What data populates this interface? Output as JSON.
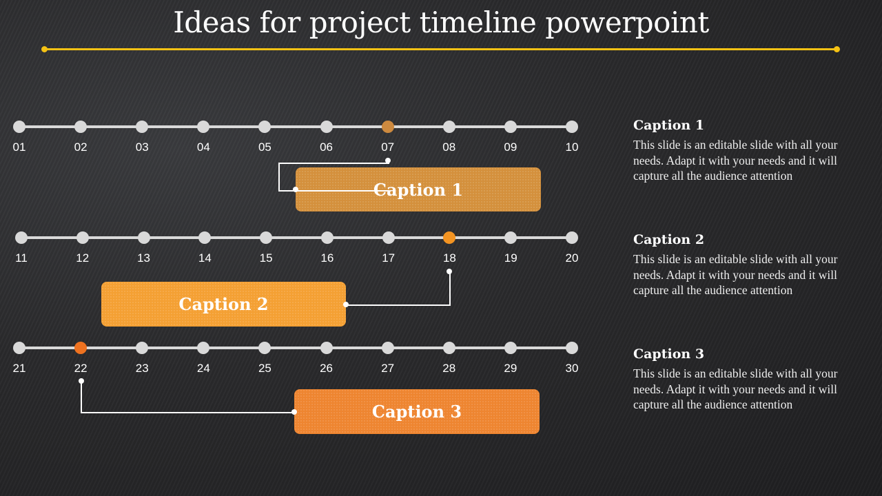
{
  "title": "Ideas for project timeline powerpoint",
  "colors": {
    "title_rule": "#f5c214",
    "track": "#d9d9d9",
    "caption1": "#d4903c",
    "caption2": "#f4a033",
    "caption3": "#ee8530",
    "marker1": "#cd8a3f",
    "marker2": "#f39422",
    "marker3": "#ee7220"
  },
  "timelines": [
    {
      "ticks": [
        "01",
        "02",
        "03",
        "04",
        "05",
        "06",
        "07",
        "08",
        "09",
        "10"
      ],
      "highlight_index": 6,
      "caption": "Caption 1"
    },
    {
      "ticks": [
        "11",
        "12",
        "13",
        "14",
        "15",
        "16",
        "17",
        "18",
        "19",
        "20"
      ],
      "highlight_index": 7,
      "caption": "Caption 2"
    },
    {
      "ticks": [
        "21",
        "22",
        "23",
        "24",
        "25",
        "26",
        "27",
        "28",
        "29",
        "30"
      ],
      "highlight_index": 1,
      "caption": "Caption 3"
    }
  ],
  "side_captions": [
    {
      "heading": "Caption 1",
      "text": "This slide is an editable slide with all your needs. Adapt it with your needs and it will capture all the audience attention"
    },
    {
      "heading": "Caption 2",
      "text": "This slide is an editable slide with all your needs. Adapt it with your needs and it will capture all the audience attention"
    },
    {
      "heading": "Caption 3",
      "text": "This slide is an editable slide with all your needs. Adapt it with your needs and it will capture all the audience attention"
    }
  ]
}
